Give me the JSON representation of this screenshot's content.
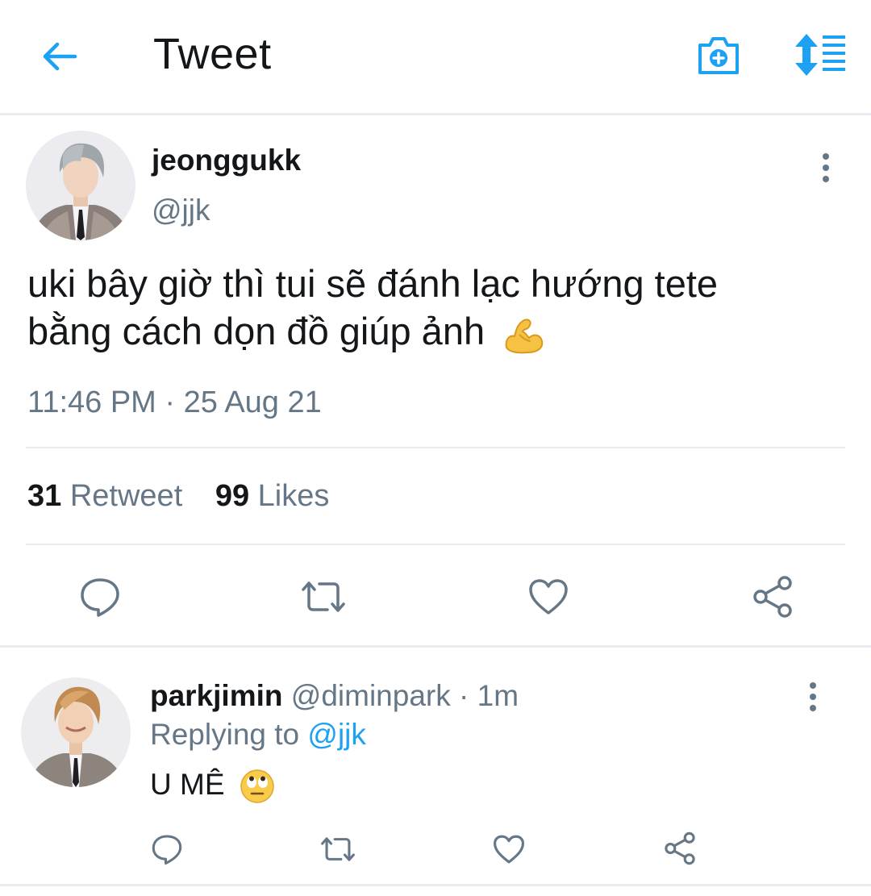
{
  "header": {
    "title": "Tweet",
    "accent_color": "#1da1f2",
    "icons": [
      "back-arrow-icon",
      "camera-plus-icon",
      "sort-lines-icon"
    ]
  },
  "tweet": {
    "display_name": "jeonggukk",
    "handle": "@jjk",
    "text_line1": "uki bây giờ thì tui sẽ đánh lạc hướng tete",
    "text_line2": "bằng cách dọn đồ giúp ảnh",
    "emoji": "flexed-biceps-emoji",
    "timestamp": "11:46 PM · 25 Aug 21",
    "retweet_count": "31",
    "retweet_label": "Retweet",
    "likes_count": "99",
    "likes_label": "Likes",
    "actions": [
      "reply-icon",
      "retweet-icon",
      "like-icon",
      "share-icon"
    ]
  },
  "reply": {
    "display_name": "parkjimin",
    "handle_time": "@diminpark · 1m",
    "replying_prefix": "Replying to",
    "replying_mention": "@jjk",
    "text": "U MÊ",
    "emoji": "eye-roll-emoji",
    "actions": [
      "reply-icon",
      "retweet-icon",
      "like-icon",
      "share-icon"
    ]
  }
}
